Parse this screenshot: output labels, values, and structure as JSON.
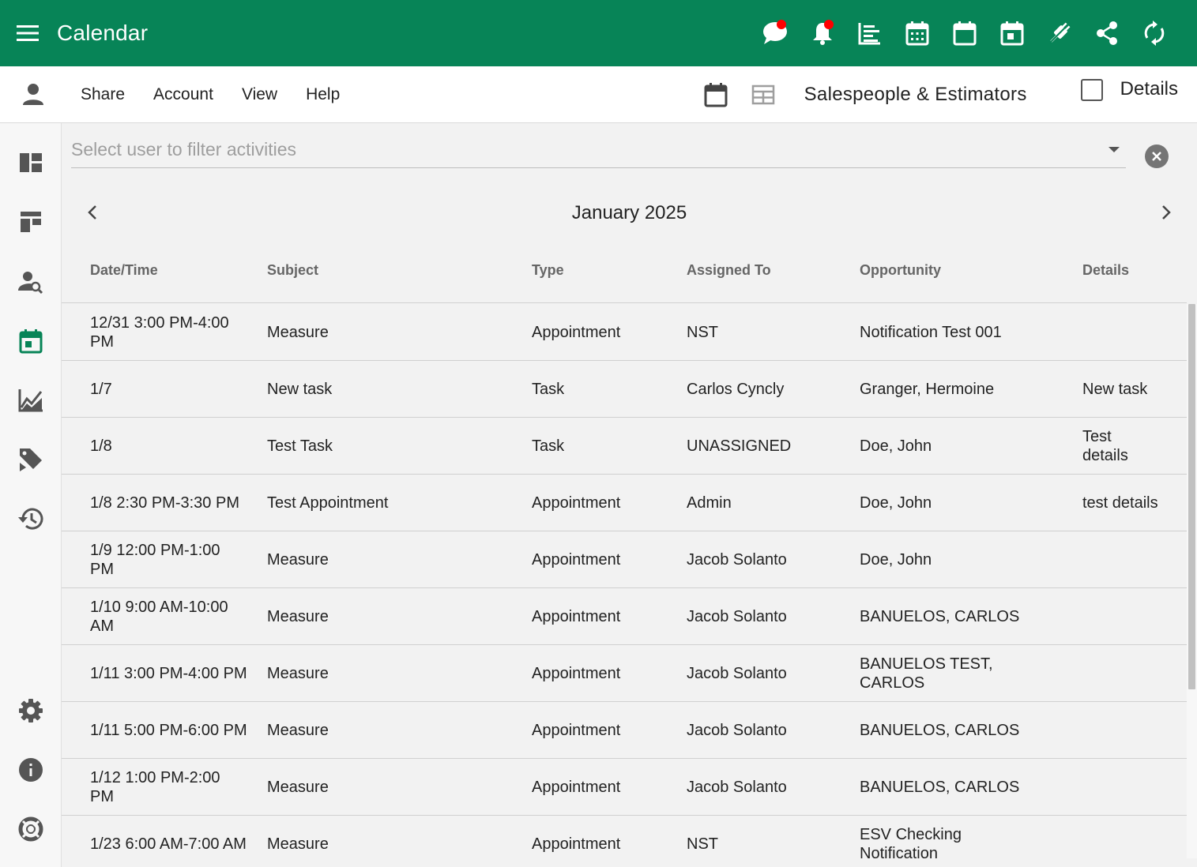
{
  "appbar": {
    "title": "Calendar",
    "icons": [
      "menu-icon",
      "chat-icon",
      "bell-icon",
      "gantt-icon",
      "calendar-grid-icon",
      "calendar-blank-icon",
      "calendar-today-icon",
      "plug-icon",
      "share-icon",
      "sync-icon"
    ],
    "accent": "#078457",
    "notification_dot_color": "#ff0000"
  },
  "toolbar": {
    "menu": [
      "Share",
      "Account",
      "View",
      "Help"
    ],
    "group_label": "Salespeople & Estimators",
    "details_label": "Details",
    "details_checked": false
  },
  "sidebar": {
    "items": [
      "dashboard-icon",
      "board-icon",
      "person-search-icon",
      "calendar-icon",
      "chart-icon",
      "tag-icon",
      "history-icon",
      "settings-icon",
      "info-icon",
      "help-lifebuoy-icon"
    ],
    "active": "calendar-icon"
  },
  "filter": {
    "placeholder": "Select user to filter activities",
    "value": ""
  },
  "calendar": {
    "month_label": "January 2025"
  },
  "table": {
    "columns": [
      "Date/Time",
      "Subject",
      "Type",
      "Assigned To",
      "Opportunity",
      "Details"
    ],
    "rows": [
      {
        "date": "12/31 3:00 PM-4:00 PM",
        "subject": "Measure",
        "type": "Appointment",
        "assigned": "NST",
        "opportunity": "Notification Test 001",
        "details": ""
      },
      {
        "date": "1/7",
        "subject": "New task",
        "type": "Task",
        "assigned": "Carlos Cyncly",
        "opportunity": "Granger, Hermoine",
        "details": "New task"
      },
      {
        "date": "1/8",
        "subject": "Test Task",
        "type": "Task",
        "assigned": "UNASSIGNED",
        "opportunity": "Doe, John",
        "details": "Test details"
      },
      {
        "date": "1/8 2:30 PM-3:30 PM",
        "subject": "Test Appointment",
        "type": "Appointment",
        "assigned": "Admin",
        "opportunity": "Doe, John",
        "details": "test details"
      },
      {
        "date": "1/9 12:00 PM-1:00 PM",
        "subject": "Measure",
        "type": "Appointment",
        "assigned": "Jacob Solanto",
        "opportunity": "Doe, John",
        "details": ""
      },
      {
        "date": "1/10 9:00 AM-10:00 AM",
        "subject": "Measure",
        "type": "Appointment",
        "assigned": "Jacob Solanto",
        "opportunity": "BANUELOS, CARLOS",
        "details": ""
      },
      {
        "date": "1/11 3:00 PM-4:00 PM",
        "subject": "Measure",
        "type": "Appointment",
        "assigned": "Jacob Solanto",
        "opportunity": "BANUELOS TEST, CARLOS",
        "details": ""
      },
      {
        "date": "1/11 5:00 PM-6:00 PM",
        "subject": "Measure",
        "type": "Appointment",
        "assigned": "Jacob Solanto",
        "opportunity": "BANUELOS, CARLOS",
        "details": ""
      },
      {
        "date": "1/12 1:00 PM-2:00 PM",
        "subject": "Measure",
        "type": "Appointment",
        "assigned": "Jacob Solanto",
        "opportunity": "BANUELOS, CARLOS",
        "details": ""
      },
      {
        "date": "1/23 6:00 AM-7:00 AM",
        "subject": "Measure",
        "type": "Appointment",
        "assigned": "NST",
        "opportunity": "ESV Checking Notification",
        "details": ""
      }
    ]
  }
}
